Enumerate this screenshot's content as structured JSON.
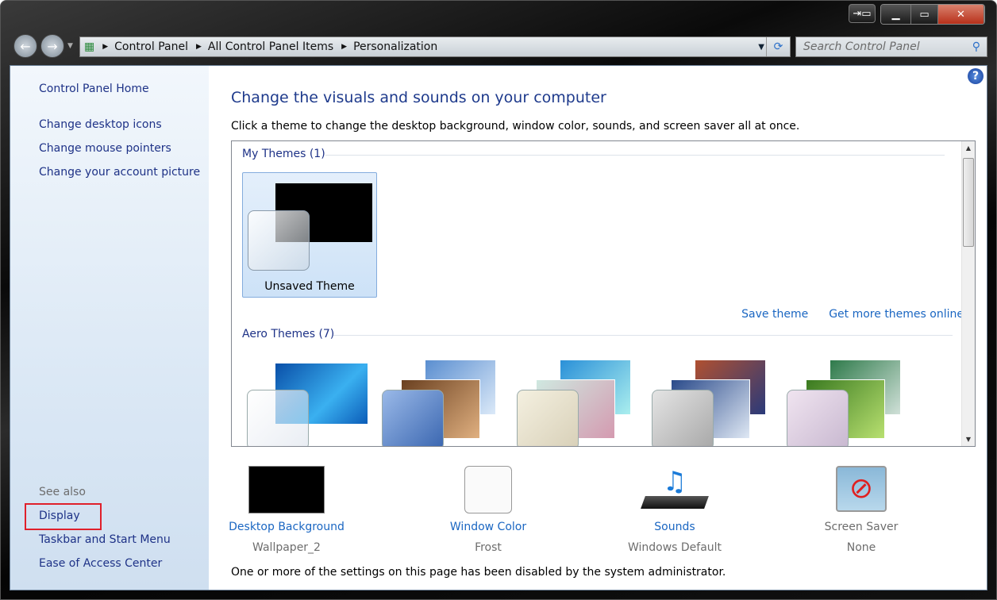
{
  "window": {
    "caption_buttons": [
      "remote-icon",
      "minimize",
      "maximize",
      "close"
    ]
  },
  "nav": {
    "back": "←",
    "forward": "→"
  },
  "address": {
    "breadcrumb": [
      "Control Panel",
      "All Control Panel Items",
      "Personalization"
    ]
  },
  "search": {
    "placeholder": "Search Control Panel"
  },
  "sidebar": {
    "home": "Control Panel Home",
    "links": [
      "Change desktop icons",
      "Change mouse pointers",
      "Change your account picture"
    ],
    "see_also": "See also",
    "see_also_links": [
      "Display",
      "Taskbar and Start Menu",
      "Ease of Access Center"
    ]
  },
  "main": {
    "title": "Change the visuals and sounds on your computer",
    "intro": "Click a theme to change the desktop background, window color, sounds, and screen saver all at once.",
    "my_themes": "My Themes (1)",
    "unsaved_theme": "Unsaved Theme",
    "save_theme": "Save theme",
    "get_more": "Get more themes online",
    "aero_themes": "Aero Themes (7)",
    "settings": [
      {
        "name": "Desktop Background",
        "value": "Wallpaper_2"
      },
      {
        "name": "Window Color",
        "value": "Frost"
      },
      {
        "name": "Sounds",
        "value": "Windows Default"
      },
      {
        "name": "Screen Saver",
        "value": "None"
      }
    ],
    "note": "One or more of the settings on this page has been disabled by the system administrator."
  },
  "colors": {
    "link": "#1a66c2",
    "heading": "#1e3a8c",
    "highlight_box": "#e0202b"
  }
}
